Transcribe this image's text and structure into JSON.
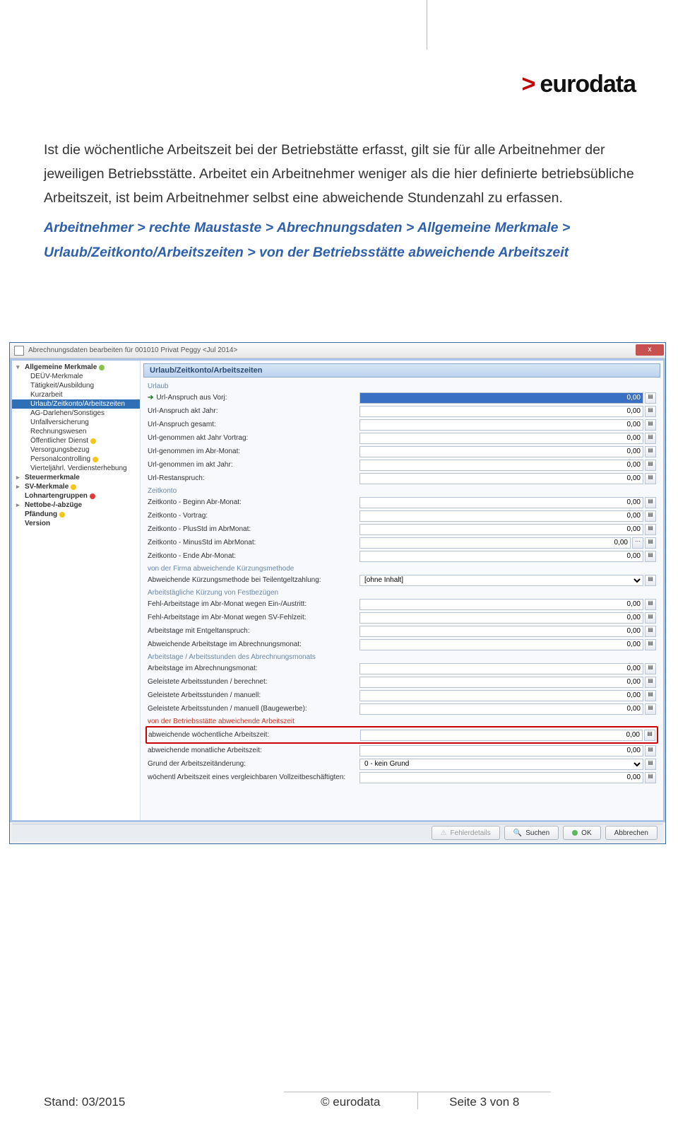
{
  "logo": {
    "brand": "eurodata"
  },
  "doc": {
    "p1": "Ist die wöchentliche Arbeitszeit bei der Betriebstätte erfasst, gilt sie für alle Arbeitnehmer der jeweiligen Betriebsstätte. Arbeitet ein Arbeitnehmer weniger als die hier definierte betriebsübliche Arbeitszeit, ist beim Arbeitnehmer selbst eine abweichende Stundenzahl zu erfassen.",
    "nav": "Arbeitnehmer > rechte Maustaste > Abrechnungsdaten > Allgemeine Merkmale > Urlaub/Zeitkonto/Arbeitszeiten > von der Betriebsstätte abweichende Arbeitszeit"
  },
  "win": {
    "title": "Abrechnungsdaten bearbeiten für 001010 Privat Peggy <Jul 2014>",
    "close": "x"
  },
  "tree": [
    {
      "label": "Allgemeine Merkmale",
      "bold": true,
      "exp": "▾",
      "dot": "g"
    },
    {
      "label": "DEÜV-Merkmale",
      "child": true
    },
    {
      "label": "Tätigkeit/Ausbildung",
      "child": true
    },
    {
      "label": "Kurzarbeit",
      "child": true
    },
    {
      "label": "Urlaub/Zeitkonto/Arbeitszeiten",
      "child": true,
      "sel": true
    },
    {
      "label": "AG-Darlehen/Sonstiges",
      "child": true
    },
    {
      "label": "Unfallversicherung",
      "child": true
    },
    {
      "label": "Rechnungswesen",
      "child": true
    },
    {
      "label": "Öffentlicher Dienst",
      "child": true,
      "dot": "y"
    },
    {
      "label": "Versorgungsbezug",
      "child": true
    },
    {
      "label": "Personalcontrolling",
      "child": true,
      "dot": "y"
    },
    {
      "label": "Vierteljährl. Verdiensterhebung",
      "child": true
    },
    {
      "label": "Steuermerkmale",
      "bold": true,
      "exp": "▸"
    },
    {
      "label": "SV-Merkmale",
      "bold": true,
      "exp": "▸",
      "dot": "y"
    },
    {
      "label": "Lohnartengruppen",
      "bold": true,
      "dot": "r"
    },
    {
      "label": "Nettobe-/-abzüge",
      "bold": true,
      "exp": "▸"
    },
    {
      "label": "Pfändung",
      "bold": true,
      "dot": "y"
    },
    {
      "label": "Version",
      "bold": true
    }
  ],
  "panel": {
    "header": "Urlaub/Zeitkonto/Arbeitszeiten",
    "groups": [
      {
        "title": "Urlaub",
        "rows": [
          {
            "label": "Url-Anspruch aus Vorj:",
            "value": "0,00",
            "selected": true,
            "arrow": true
          },
          {
            "label": "Url-Anspruch akt Jahr:",
            "value": "0,00"
          },
          {
            "label": "Url-Anspruch gesamt:",
            "value": "0,00"
          },
          {
            "label": "Url-genommen akt Jahr Vortrag:",
            "value": "0,00"
          },
          {
            "label": "Url-genommen im Abr-Monat:",
            "value": "0,00"
          },
          {
            "label": "Url-genommen im akt Jahr:",
            "value": "0,00"
          },
          {
            "label": "Url-Restanspruch:",
            "value": "0,00"
          }
        ]
      },
      {
        "title": "Zeitkonto",
        "rows": [
          {
            "label": "Zeitkonto - Beginn Abr-Monat:",
            "value": "0,00"
          },
          {
            "label": "Zeitkonto - Vortrag:",
            "value": "0,00"
          },
          {
            "label": "Zeitkonto - PlusStd im AbrMonat:",
            "value": "0,00"
          },
          {
            "label": "Zeitkonto - MinusStd im AbrMonat:",
            "value": "0,00",
            "extra": true
          },
          {
            "label": "Zeitkonto - Ende Abr-Monat:",
            "value": "0,00"
          }
        ]
      },
      {
        "title": "von der Firma abweichende Kürzungsmethode",
        "rows": [
          {
            "label": "Abweichende Kürzungsmethode bei Teilentgeltzahlung:",
            "value": "[ohne Inhalt]",
            "dropdown": true
          }
        ]
      },
      {
        "title": "Arbeitstägliche Kürzung von Festbezügen",
        "rows": [
          {
            "label": "Fehl-Arbeitstage im Abr-Monat wegen Ein-/Austritt:",
            "value": "0,00"
          },
          {
            "label": "Fehl-Arbeitstage im Abr-Monat wegen SV-Fehlzeit:",
            "value": "0,00"
          },
          {
            "label": "Arbeitstage mit Entgeltanspruch:",
            "value": "0,00"
          },
          {
            "label": "Abweichende Arbeitstage im Abrechnungsmonat:",
            "value": "0,00"
          }
        ]
      },
      {
        "title": "Arbeitstage / Arbeitsstunden des Abrechnungsmonats",
        "rows": [
          {
            "label": "Arbeitstage im Abrechnungsmonat:",
            "value": "0,00"
          },
          {
            "label": "Geleistete Arbeitsstunden / berechnet:",
            "value": "0,00"
          },
          {
            "label": "Geleistete Arbeitsstunden / manuell:",
            "value": "0,00"
          },
          {
            "label": "Geleistete Arbeitsstunden / manuell (Baugewerbe):",
            "value": "0,00"
          }
        ]
      },
      {
        "title": "von der Betriebsstätte abweichende Arbeitszeit",
        "hl": true,
        "rows": [
          {
            "label": "abweichende wöchentliche Arbeitszeit:",
            "value": "0,00",
            "redbox": true
          },
          {
            "label": "abweichende monatliche Arbeitszeit:",
            "value": "0,00"
          },
          {
            "label": "Grund der Arbeitszeitänderung:",
            "value": "0 - kein Grund",
            "dropdown": true
          },
          {
            "label": "wöchentl Arbeitszeit eines vergleichbaren Vollzeitbeschäftigten:",
            "value": "0,00"
          }
        ]
      }
    ]
  },
  "buttons": {
    "fehler": "Fehlerdetails",
    "suchen": "Suchen",
    "ok": "OK",
    "abbrechen": "Abbrechen"
  },
  "footer": {
    "stand": "Stand: 03/2015",
    "copyright": "© eurodata",
    "page_prefix": "Seite ",
    "page_num": "3",
    "page_suffix": " von 8"
  }
}
